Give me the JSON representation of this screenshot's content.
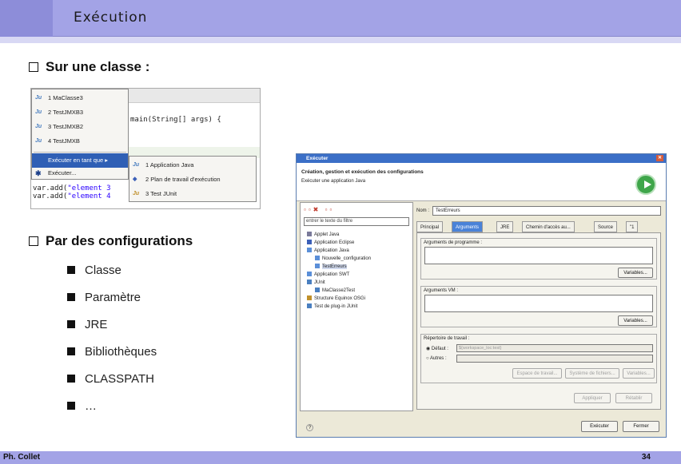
{
  "slide": {
    "title": "Exécution",
    "bullet1": "Sur une classe :",
    "bullet2": "Par des configurations",
    "sub_items": [
      "Classe",
      "Paramètre",
      "JRE",
      "Bibliothèques",
      "CLASSPATH",
      "…"
    ],
    "footer_left": "Ph. Collet",
    "footer_right": "34"
  },
  "context_menu": {
    "recent": [
      {
        "icon": "Ju",
        "label": "1 MaClasse3"
      },
      {
        "icon": "Ju",
        "label": "2 TestJMXB3"
      },
      {
        "icon": "Ju",
        "label": "3 TestJMXB2"
      },
      {
        "icon": "Ju",
        "label": "4 TestJMXB"
      }
    ],
    "run_as": "Exécuter en tant que ▸",
    "run": "Exécuter...",
    "submenu": [
      {
        "icon": "Ju",
        "label": "1 Application Java"
      },
      {
        "icon": "◆",
        "label": "2 Plan de travail d'exécution"
      },
      {
        "icon": "Ju",
        "label": "3 Test JUnit"
      }
    ],
    "code_line1": "main(String[] args) {",
    "code_line2a": "var.add(",
    "code_line2b": "\"element 3",
    "code_line3a": "var.add(",
    "code_line3b": "\"element 4"
  },
  "dialog": {
    "window_title": "Exécuter",
    "heading": "Création, gestion et exécution des configurations",
    "description": "Exécuter une application Java",
    "filter_placeholder": "entrer le texte du filtre",
    "tree": [
      {
        "label": "Applet Java",
        "indent": 0,
        "color": "#7a7a9a"
      },
      {
        "label": "Application Eclipse",
        "indent": 0,
        "color": "#3b5fb8"
      },
      {
        "label": "Application Java",
        "indent": 0,
        "color": "#5b8fd8"
      },
      {
        "label": "Nouvelle_configuration",
        "indent": 1,
        "color": "#5b8fd8"
      },
      {
        "label": "TestErreurs",
        "indent": 1,
        "color": "#5b8fd8",
        "selected": true
      },
      {
        "label": "Application SWT",
        "indent": 0,
        "color": "#5b8fd8"
      },
      {
        "label": "JUnit",
        "indent": 0,
        "color": "#4a7fc0"
      },
      {
        "label": "MaClasse2Test",
        "indent": 1,
        "color": "#4a7fc0"
      },
      {
        "label": "Structure Equinox OSGi",
        "indent": 0,
        "color": "#c0902b"
      },
      {
        "label": "Test de plug-in JUnit",
        "indent": 0,
        "color": "#4a7fc0"
      }
    ],
    "name_label": "Nom :",
    "name_value": "TestErreurs",
    "tabs": [
      "Principal",
      "Arguments",
      "JRE",
      "Chemin d'accès au...",
      "Source",
      "\"1"
    ],
    "prog_args_label": "Arguments de programme :",
    "vm_args_label": "Arguments VM :",
    "variables_btn": "Variables...",
    "workdir_label": "Répertoire de travail :",
    "default_label": "Défaut :",
    "default_value": "${workspace_loc:test}",
    "other_label": "Autres :",
    "workspace_btn": "Espace de travail...",
    "filesystem_btn": "Système de fichiers...",
    "variables_btn2": "Variables...",
    "apply_btn": "Appliquer",
    "revert_btn": "Rétablir",
    "run_btn": "Exécuter",
    "close_btn": "Fermer",
    "help": "?"
  }
}
